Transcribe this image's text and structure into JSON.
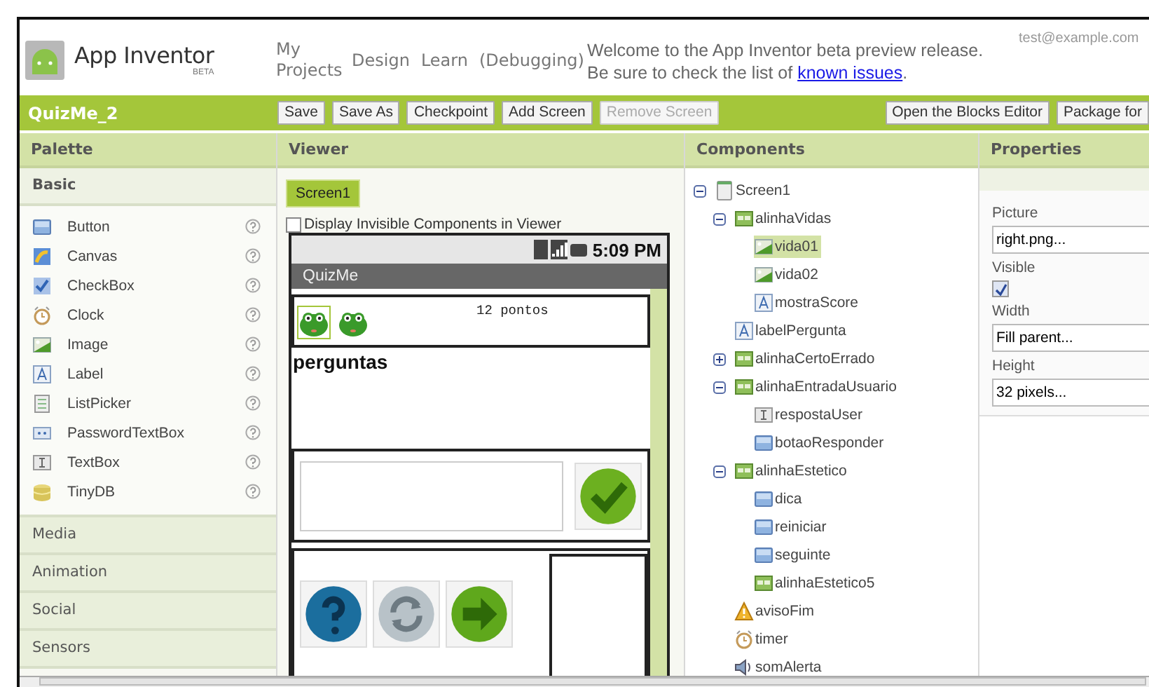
{
  "header": {
    "app_name": "App Inventor",
    "badge": "BETA",
    "nav": [
      {
        "label": "My Projects"
      },
      {
        "label": "Design"
      },
      {
        "label": "Learn"
      },
      {
        "label": "(Debugging)"
      }
    ],
    "message": "Welcome to the App Inventor beta preview release. Be sure to check the list of ",
    "message_link": "known issues",
    "message_end": ".",
    "user": "test@example.com"
  },
  "toolbar": {
    "project": "QuizMe_2",
    "buttons": [
      {
        "label": "Save",
        "disabled": false
      },
      {
        "label": "Save As",
        "disabled": false
      },
      {
        "label": "Checkpoint",
        "disabled": false
      },
      {
        "label": "Add Screen",
        "disabled": false
      },
      {
        "label": "Remove Screen",
        "disabled": true
      }
    ],
    "right_buttons": [
      {
        "label": "Open the Blocks Editor",
        "disabled": false
      },
      {
        "label": "Package for",
        "disabled": false
      }
    ]
  },
  "palette": {
    "title": "Palette",
    "groups": [
      {
        "label": "Basic",
        "expanded": true,
        "items": [
          {
            "label": "Button",
            "kind": "button"
          },
          {
            "label": "Canvas",
            "kind": "canvas"
          },
          {
            "label": "CheckBox",
            "kind": "checkbox"
          },
          {
            "label": "Clock",
            "kind": "clock"
          },
          {
            "label": "Image",
            "kind": "image"
          },
          {
            "label": "Label",
            "kind": "label"
          },
          {
            "label": "ListPicker",
            "kind": "listpicker"
          },
          {
            "label": "PasswordTextBox",
            "kind": "password"
          },
          {
            "label": "TextBox",
            "kind": "textbox"
          },
          {
            "label": "TinyDB",
            "kind": "db"
          }
        ]
      },
      {
        "label": "Media",
        "expanded": false
      },
      {
        "label": "Animation",
        "expanded": false
      },
      {
        "label": "Social",
        "expanded": false
      },
      {
        "label": "Sensors",
        "expanded": false
      }
    ]
  },
  "viewer": {
    "title": "Viewer",
    "screen_tab": "Screen1",
    "show_invisible": {
      "label": "Display Invisible Components in Viewer",
      "checked": false
    },
    "phone": {
      "time": "5:09 PM",
      "app_title": "QuizMe",
      "lives": [
        {
          "selected": true
        },
        {
          "selected": false
        }
      ],
      "score": "12 pontos",
      "question": "perguntas"
    }
  },
  "components": {
    "title": "Components",
    "tree": [
      {
        "label": "Screen1",
        "kind": "screen",
        "expanded": true,
        "selected": false,
        "children": [
          {
            "label": "alinhaVidas",
            "kind": "arrangement",
            "expanded": true,
            "selected": false,
            "children": [
              {
                "label": "vida01",
                "kind": "image",
                "selected": true
              },
              {
                "label": "vida02",
                "kind": "image",
                "selected": false
              },
              {
                "label": "mostraScore",
                "kind": "label",
                "selected": false
              }
            ]
          },
          {
            "label": "labelPergunta",
            "kind": "label",
            "selected": false
          },
          {
            "label": "alinhaCertoErrado",
            "kind": "arrangement",
            "expanded": false,
            "selected": false
          },
          {
            "label": "alinhaEntradaUsuario",
            "kind": "arrangement",
            "expanded": true,
            "selected": false,
            "children": [
              {
                "label": "respostaUser",
                "kind": "textbox",
                "selected": false
              },
              {
                "label": "botaoResponder",
                "kind": "button",
                "selected": false
              }
            ]
          },
          {
            "label": "alinhaEstetico",
            "kind": "arrangement",
            "expanded": true,
            "selected": false,
            "children": [
              {
                "label": "dica",
                "kind": "button",
                "selected": false
              },
              {
                "label": "reiniciar",
                "kind": "button",
                "selected": false
              },
              {
                "label": "seguinte",
                "kind": "button",
                "selected": false
              },
              {
                "label": "alinhaEstetico5",
                "kind": "arrangement",
                "selected": false
              }
            ]
          },
          {
            "label": "avisoFim",
            "kind": "notifier",
            "selected": false
          },
          {
            "label": "timer",
            "kind": "clock",
            "selected": false
          },
          {
            "label": "somAlerta",
            "kind": "sound",
            "selected": false
          }
        ]
      }
    ]
  },
  "properties": {
    "title": "Properties",
    "fields": [
      {
        "label": "Picture",
        "kind": "text",
        "value": "right.png..."
      },
      {
        "label": "Visible",
        "kind": "checkbox",
        "checked": true
      },
      {
        "label": "Width",
        "kind": "text",
        "value": "Fill parent..."
      },
      {
        "label": "Height",
        "kind": "text",
        "value": "32 pixels..."
      }
    ]
  }
}
